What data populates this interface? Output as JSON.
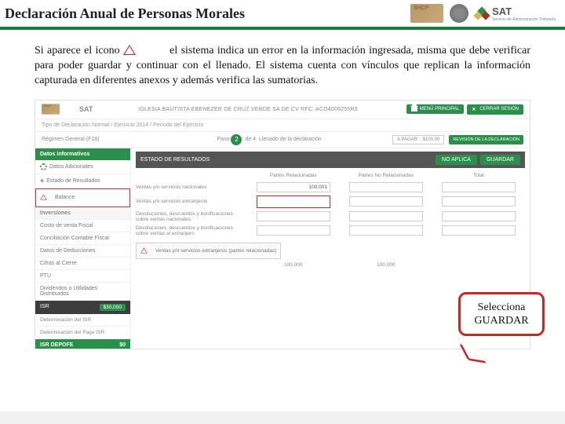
{
  "header": {
    "title": "Declaración Anual de Personas Morales",
    "sat_label": "SAT",
    "sat_sub": "Servicio de Administración Tributaria"
  },
  "body": {
    "text_before": "Si aparece el icono",
    "text_after": "el sistema indica un error en la información ingresada, misma que debe verificar para poder guardar y continuar con el llenado. El sistema cuenta con vínculos que replican la información capturada en diferentes anexos y además verifica las sumatorias."
  },
  "app": {
    "company": "IGLESIA BAUTISTA EBENEZER DE CRUZ VERDE SA DE CV  RFC: ACO4006255R5",
    "menu_btn": "MENÚ PRINCIPAL",
    "close_btn": "CERRAR SESIÓN",
    "crumb": "Tipo de Declaración Normal / Ejercicio 2014 / Período del Ejercicio",
    "regimen": "Régimen General (F18)",
    "step_num": "2",
    "step_label": "Paso",
    "step_desc": "de 4. Llenado de la declaración",
    "pay_label": "A PAGAR:",
    "pay_value": "$100.00",
    "rev_btn": "REVISIÓN DE LA DECLARACIÓN",
    "sidebar": {
      "head": "Datos informativos",
      "items": [
        "Datos Adicionales",
        "Estado de Resultados",
        "Balance",
        "Inversiones",
        "Costo de venta Fiscal",
        "Conciliación Contable Fiscal",
        "Datos de Deducciones",
        "Cifras al Cierre",
        "PTU",
        "Dividendos o Utilidades Distribuidos"
      ],
      "isr_label": "ISR",
      "isr_amount": "$30,000",
      "isr_sub1": "Determinación del ISR",
      "isr_sub2": "Determinación del Pago ISR",
      "depofe": "ISR DEPOFE",
      "depofe_amt": "$0"
    },
    "content": {
      "bar_title": "ESTADO DE RESULTADOS",
      "no_aplica": "NO APLICA",
      "guardar": "GUARDAR",
      "col1": "Partes Relacionadas",
      "col2": "Partes No Relacionadas",
      "col3": "Total",
      "rows": [
        {
          "label": "Ventas y/o servicios nacionales",
          "v1": "100,001",
          "v2": "",
          "v3": ""
        },
        {
          "label": "Ventas y/o servicios extranjeros",
          "v1": "",
          "v2": "",
          "v3": ""
        },
        {
          "label": "Devoluciones, descuentos y bonificaciones sobre ventas nacionales",
          "v1": "",
          "v2": "",
          "v3": ""
        },
        {
          "label": "Devoluciones, descuentos y bonificaciones sobre ventas al extranjero",
          "v1": "",
          "v2": "",
          "v3": ""
        }
      ],
      "error_msg": "Ventas y/o servicios extranjeros (partes relacionadas)",
      "t1": "100,000",
      "t2": "100,000"
    }
  },
  "callout": "Selecciona GUARDAR"
}
